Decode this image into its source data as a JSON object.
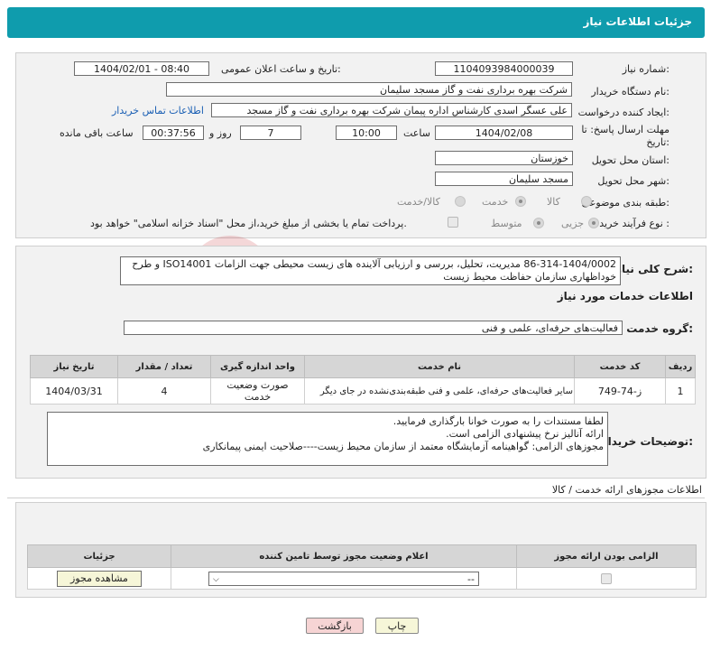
{
  "header": {
    "title": "جزئیات اطلاعات نیاز"
  },
  "form": {
    "need_number_label": "شماره نیاز:",
    "need_number": "1104093984000039",
    "announce_label": "تاریخ و ساعت اعلان عمومی:",
    "announce_value": "1404/02/01 - 08:40",
    "buyer_org_label": "نام دستگاه خریدار:",
    "buyer_org": "شرکت بهره برداری نفت و گاز مسجد سلیمان",
    "creator_label": "ایجاد کننده درخواست:",
    "creator": "علی عسگر اسدی کارشناس اداره پیمان  شرکت بهره برداری نفت و گاز مسجد",
    "buyer_contact_link": "اطلاعات تماس خریدار",
    "deadline_label": "مهلت ارسال پاسخ: تا تاریخ:",
    "deadline_date": "1404/02/08",
    "time_label": "ساعت",
    "deadline_time": "10:00",
    "days_value": "7",
    "days_label": "روز و",
    "remaining_time": "00:37:56",
    "remaining_label": "ساعت باقی مانده",
    "province_label": "استان محل تحویل:",
    "province": "خوزستان",
    "city_label": "شهر محل تحویل:",
    "city": "مسجد سلیمان",
    "category_label": "طبقه بندی موضوعی:",
    "category_options": [
      "کالا",
      "خدمت",
      "کالا/خدمت"
    ],
    "category_selected": "خدمت",
    "process_label": "نوع فرآیند خرید :",
    "process_options": [
      "جزیی",
      "متوسط"
    ],
    "process_selected": "جزیی",
    "payment_note": "پرداخت تمام یا بخشی از مبلغ خرید،از محل \"اسناد خزانه اسلامی\" خواهد بود."
  },
  "description": {
    "label": "شرح کلی نیاز:",
    "text": "86-314-1404/0002 مدیریت، تحلیل، بررسی و ارزیابی آلاینده های زیست محیطی جهت الزامات ISO14001 و طرح خوداظهاری سازمان حفاظت محیط زیست"
  },
  "services": {
    "title": "اطلاعات خدمات مورد نیاز",
    "group_label": "گروه خدمت:",
    "group_value": "فعالیت‌های حرفه‌ای، علمی و فنی",
    "columns": [
      "ردیف",
      "کد خدمت",
      "نام خدمت",
      "واحد اندازه گیری",
      "تعداد / مقدار",
      "تاریخ نیاز"
    ],
    "rows": [
      {
        "row": "1",
        "code": "ز-74-749",
        "name": "سایر فعالیت‌های حرفه‌ای، علمی و فنی طبقه‌بندی‌نشده در جای دیگر",
        "unit": "صورت وضعیت خدمت",
        "qty": "4",
        "date": "1404/03/31"
      }
    ]
  },
  "buyer_notes": {
    "label": "توضیحات خریدار:",
    "lines": [
      "لطفا مستندات را به صورت خوانا بارگذاری فرمایید.",
      "ارائه آنالیز نرخ پیشنهادی الزامی است.",
      "مجوزهای الزامی: گواهینامه آزمایشگاه معتمد از سازمان محیط زیست----صلاحیت ایمنی پیمانکاری"
    ]
  },
  "permits": {
    "title": "اطلاعات مجوزهای ارائه خدمت / کالا",
    "columns": [
      "الزامی بودن ارائه مجوز",
      "اعلام وضعیت مجوز توسط تامین کننده",
      "جزئیات"
    ],
    "select_value": "--",
    "view_button": "مشاهده مجوز"
  },
  "footer": {
    "print_button": "چاپ",
    "back_button": "بازگشت"
  },
  "watermark": {
    "text": "AriaTender.neT"
  }
}
